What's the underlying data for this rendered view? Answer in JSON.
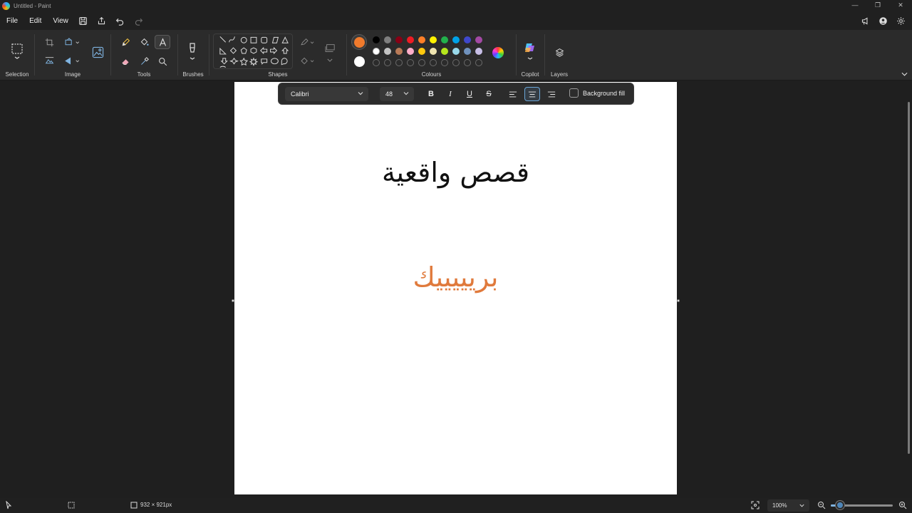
{
  "window": {
    "title": "Untitled - Paint",
    "controls": [
      "—",
      "❐",
      "✕"
    ]
  },
  "menu": {
    "file": "File",
    "edit": "Edit",
    "view": "View"
  },
  "ribbon": {
    "groups": {
      "selection": "Selection",
      "image": "Image",
      "tools": "Tools",
      "brushes": "Brushes",
      "shapes": "Shapes",
      "colours": "Colours",
      "copilot": "Copilot",
      "layers": "Layers"
    },
    "primary_colour": "#f07a2c",
    "secondary_colour": "#ffffff",
    "palette_row1": [
      "#000000",
      "#7f7f7f",
      "#880015",
      "#ed1c24",
      "#ff7f27",
      "#fff200",
      "#22b14c",
      "#00a2e8",
      "#3f48cc",
      "#a349a4"
    ],
    "palette_row2": [
      "#ffffff",
      "#c3c3c3",
      "#b97a57",
      "#ffaec9",
      "#ffc90e",
      "#efe4b0",
      "#b5e61d",
      "#99d9ea",
      "#7092be",
      "#c8bfe7"
    ]
  },
  "canvas": {
    "title_text": "قصص واقعية",
    "orange_text": "بريييييك",
    "orange_color": "#e07a3c"
  },
  "text_toolbar": {
    "font": "Calibri",
    "size": "48",
    "background_fill": "Background fill",
    "bold": "B",
    "italic": "I",
    "underline": "U",
    "strikethrough": "S"
  },
  "status": {
    "dimensions": "932 × 921px",
    "zoom": "100%",
    "zoom_level": 0.15
  }
}
